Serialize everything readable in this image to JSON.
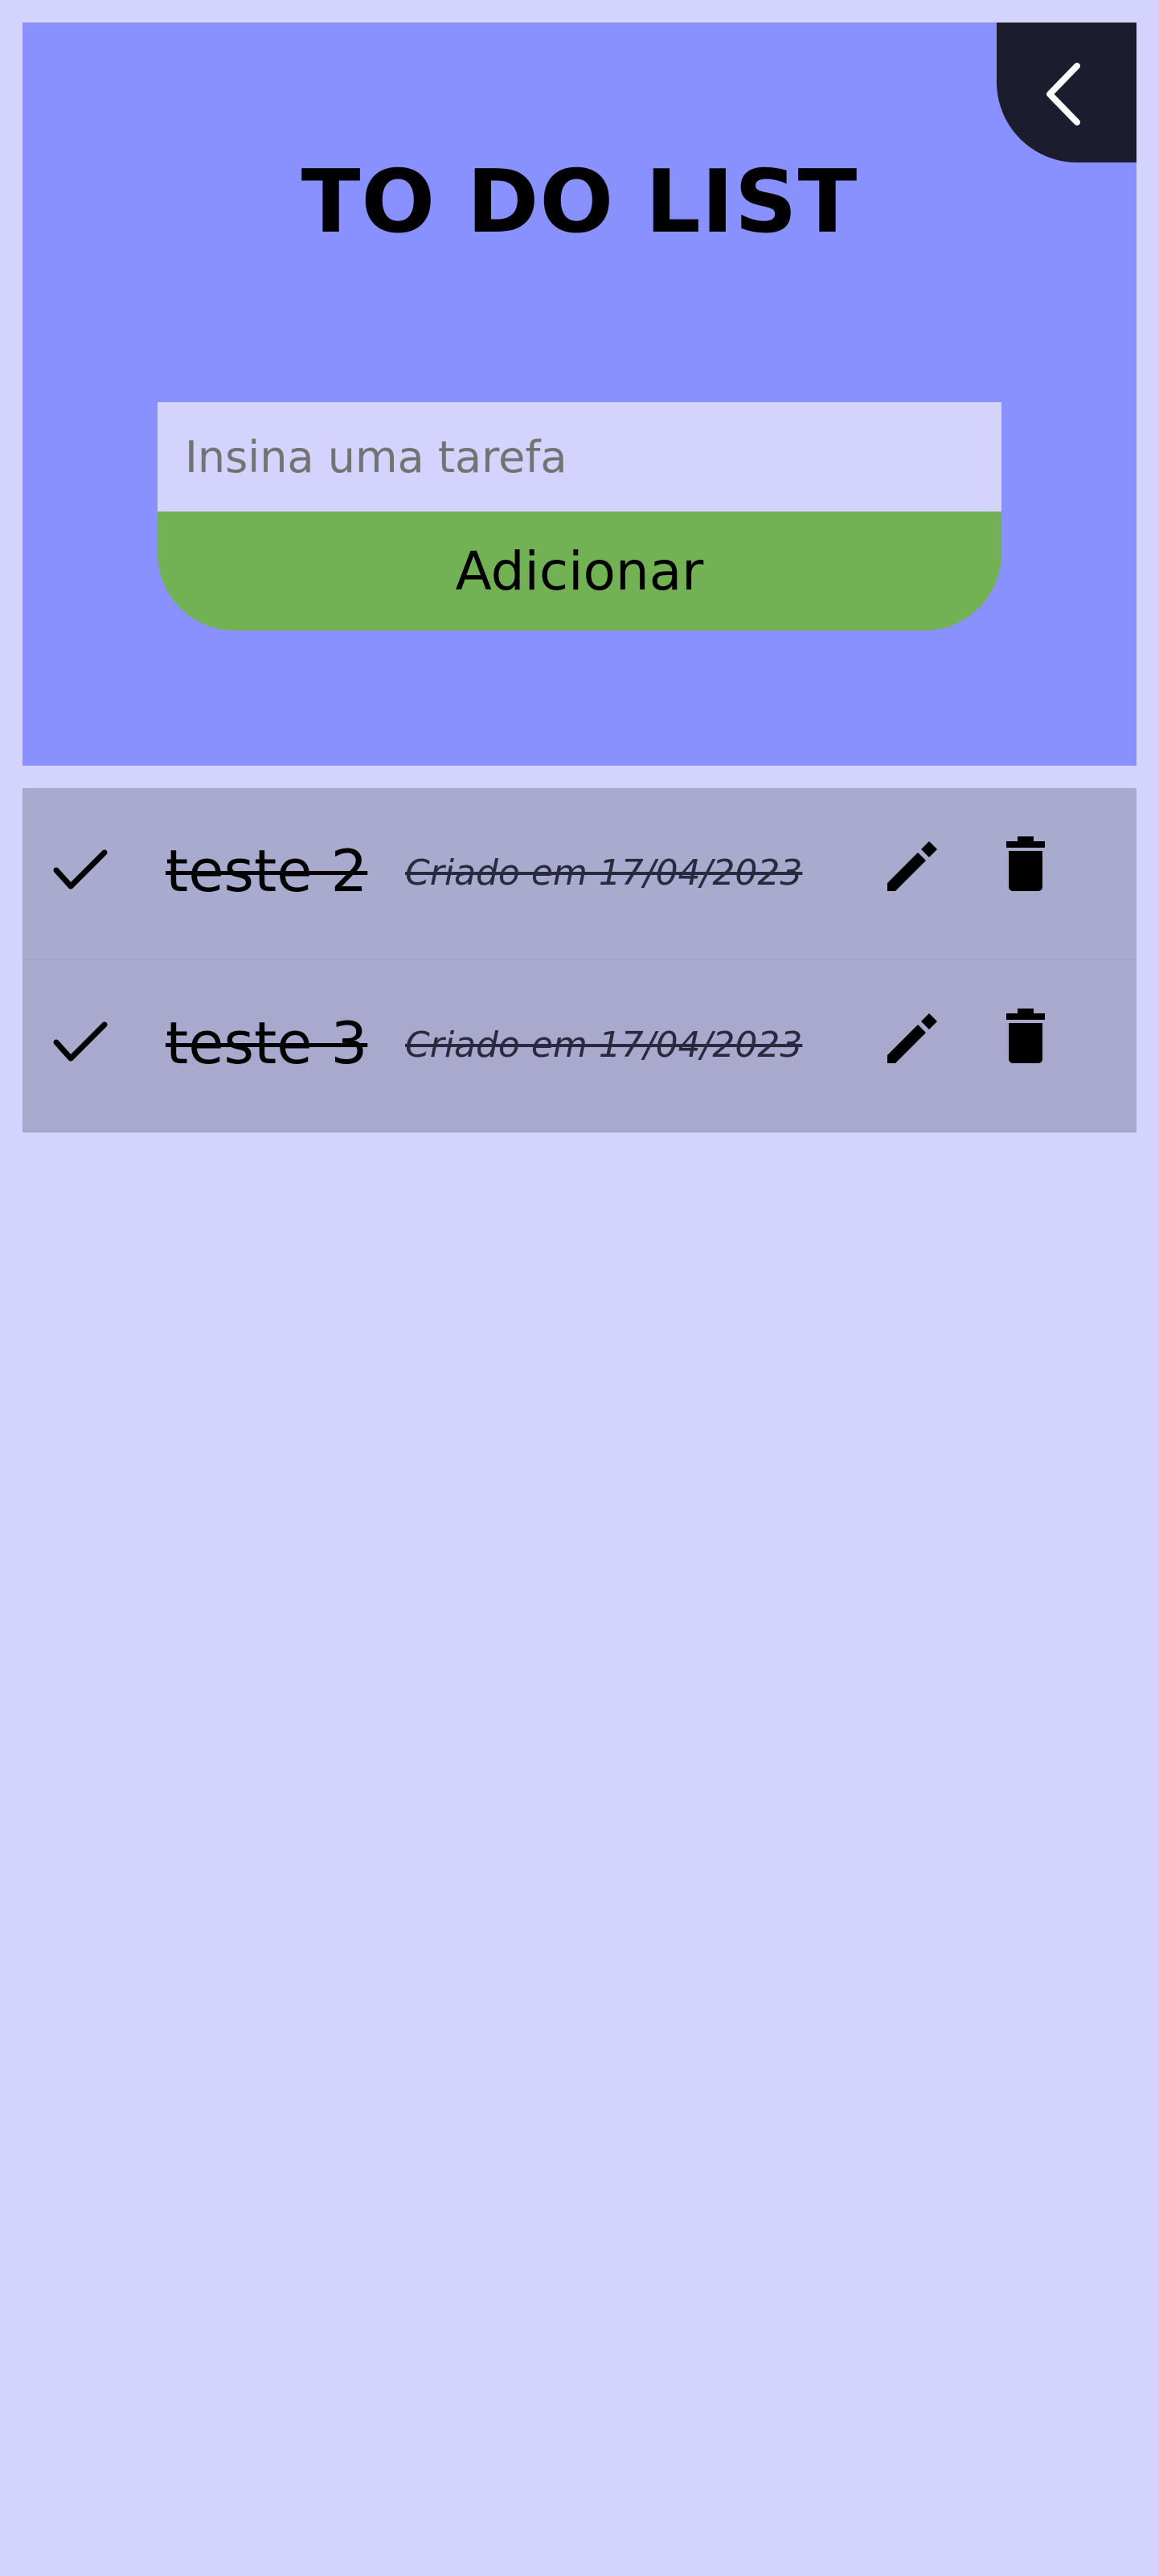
{
  "header": {
    "title": "TO DO LIST",
    "back_icon": "chevron-left-icon",
    "colors": {
      "page_background": "#d3d3fe",
      "header_background": "#8891fe",
      "back_button_background": "#1b1c2e",
      "add_button_background": "#73b155",
      "task_row_background": "#a8aace"
    }
  },
  "form": {
    "input_placeholder": "Insina uma tarefa",
    "input_value": "",
    "add_label": "Adicionar"
  },
  "tasks": [
    {
      "name": "teste 2",
      "created": "Criado em 17/04/2023",
      "completed": true,
      "icons": [
        "check-icon",
        "pencil-icon",
        "trash-icon"
      ]
    },
    {
      "name": "teste 3",
      "created": "Criado em 17/04/2023",
      "completed": true,
      "icons": [
        "check-icon",
        "pencil-icon",
        "trash-icon"
      ]
    }
  ]
}
